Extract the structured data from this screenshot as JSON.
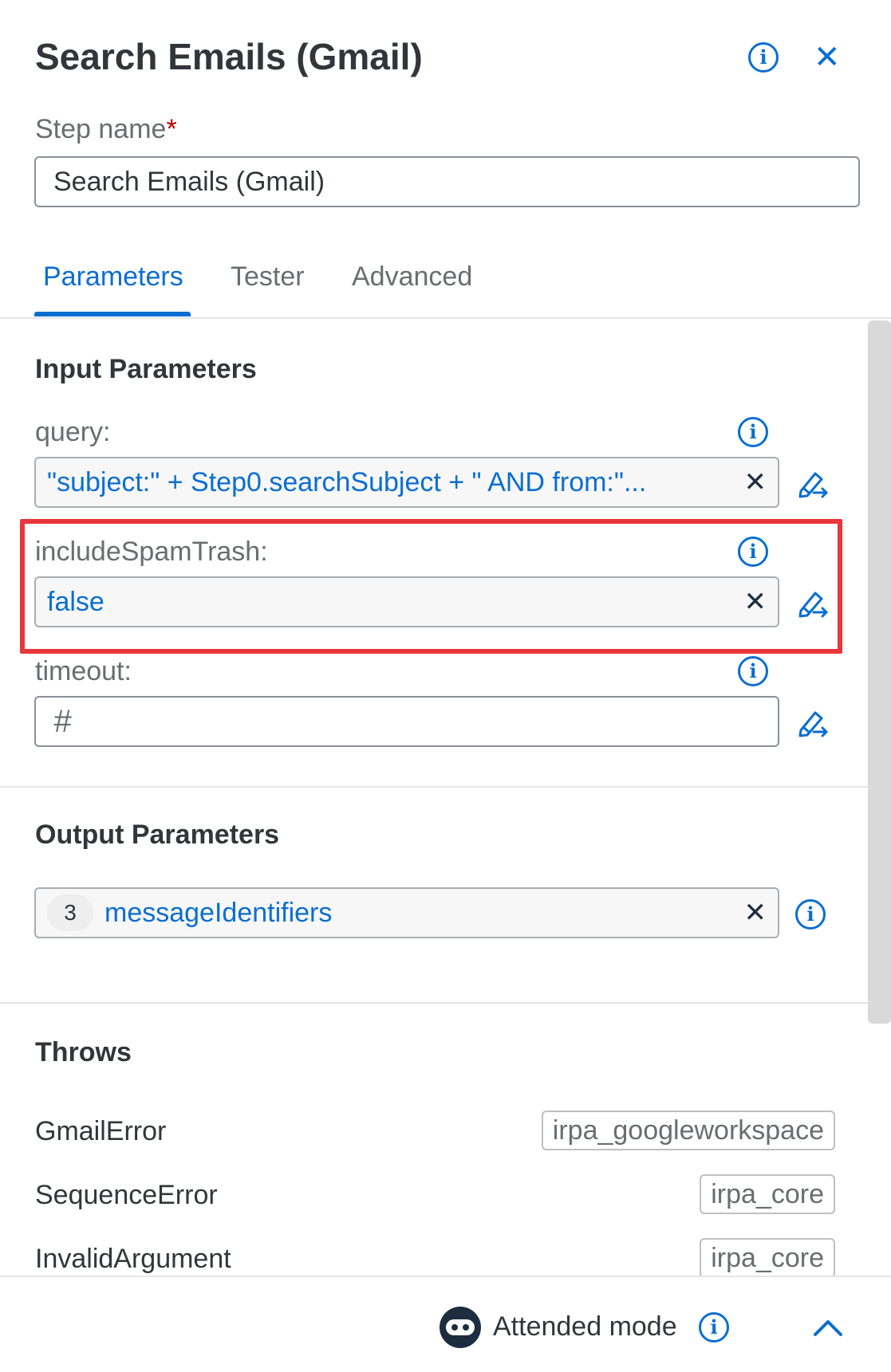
{
  "panel": {
    "title": "Search Emails (Gmail)"
  },
  "step_name": {
    "label": "Step name",
    "required_mark": "*",
    "value": "Search Emails (Gmail)"
  },
  "tabs": [
    {
      "label": "Parameters",
      "active": true
    },
    {
      "label": "Tester",
      "active": false
    },
    {
      "label": "Advanced",
      "active": false
    }
  ],
  "input_parameters": {
    "heading": "Input Parameters",
    "query": {
      "label": "query:",
      "value": "\"subject:\" + Step0.searchSubject + \" AND from:\"..."
    },
    "includeSpamTrash": {
      "label": "includeSpamTrash:",
      "value": "false"
    },
    "timeout": {
      "label": "timeout:",
      "placeholder": "#"
    }
  },
  "output_parameters": {
    "heading": "Output Parameters",
    "item": {
      "count": "3",
      "value": "messageIdentifiers"
    }
  },
  "throws": {
    "heading": "Throws",
    "items": [
      {
        "name": "GmailError",
        "tag": "irpa_googleworkspace"
      },
      {
        "name": "SequenceError",
        "tag": "irpa_core"
      },
      {
        "name": "InvalidArgument",
        "tag": "irpa_core"
      }
    ]
  },
  "footer": {
    "mode_label": "Attended mode"
  },
  "colors": {
    "accent": "#0a6ed1",
    "highlight": "#e8363b"
  },
  "icons": [
    "info-icon",
    "close-icon",
    "clear-icon",
    "edit-expression-icon",
    "robot-icon",
    "chevron-up-icon"
  ]
}
